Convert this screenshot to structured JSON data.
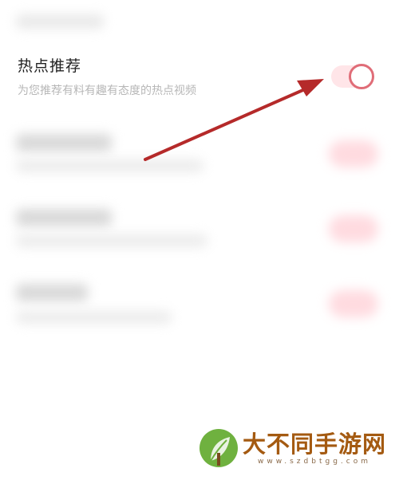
{
  "setting": {
    "title": "热点推荐",
    "description": "为您推荐有料有趣有态度的热点视频",
    "enabled": true
  },
  "colors": {
    "arrow": "#b52a2a",
    "toggle_knob": "#e06d78",
    "toggle_track": "#ffe5e8",
    "watermark_text": "#a45a11",
    "watermark_logo": "#6fb13f"
  },
  "watermark": {
    "title": "大不同手游网",
    "url": "www.szdbtgg.com",
    "icon": "leaf-logo-icon"
  }
}
